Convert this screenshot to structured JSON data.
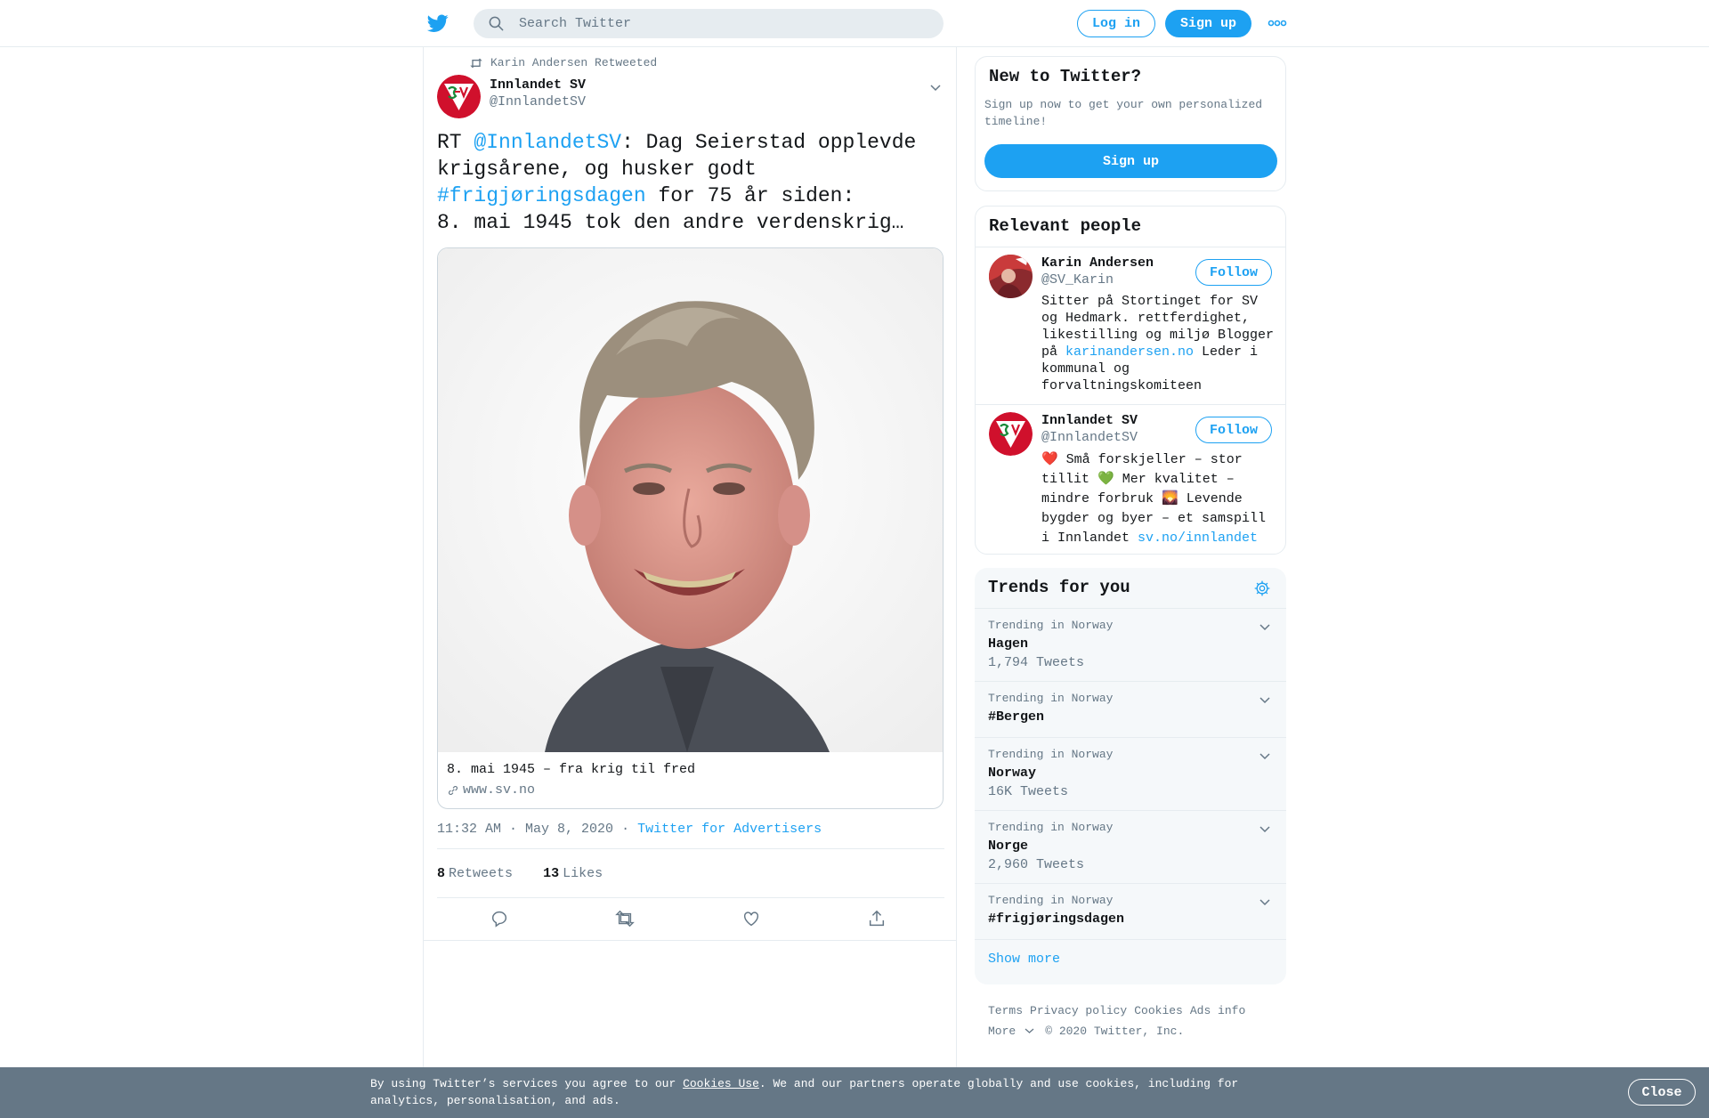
{
  "header": {
    "search_placeholder": "Search Twitter",
    "login_label": "Log in",
    "signup_label": "Sign up",
    "brand_color": "#1da1f2"
  },
  "tweet": {
    "retweeted_by": "Karin Andersen Retweeted",
    "author_name": "Innlandet SV",
    "author_handle": "@InnlandetSV",
    "text_prefix": "RT ",
    "mention": "@InnlandetSV",
    "text_part2": ": Dag Seierstad opplevde krigsårene, og husker godt ",
    "hashtag": "#frigjøringsdagen",
    "text_part3": " for 75 år siden:",
    "text_line4": "8. mai 1945 tok den andre verdenskrig…",
    "card_title": "8. mai 1945 – fra krig til fred",
    "card_domain": "www.sv.no",
    "timestamp": "11:32 AM · May 8, 2020",
    "separator": "·",
    "source": "Twitter for Advertisers",
    "retweets_count": "8",
    "retweets_label": "Retweets",
    "likes_count": "13",
    "likes_label": "Likes"
  },
  "new_to_twitter": {
    "title": "New to Twitter?",
    "text": "Sign up now to get your own personalized timeline!",
    "button": "Sign up"
  },
  "relevant_people": {
    "title": "Relevant people",
    "people": [
      {
        "name": "Karin Andersen",
        "handle": "@SV_Karin",
        "follow": "Follow",
        "bio": "Sitter på Stortinget for SV og Hedmark. rettferdighet, likestilling og miljø Blogger på ",
        "bio_link": "karinandersen.no",
        "bio_tail": " Leder i kommunal og forvaltningskomiteen"
      },
      {
        "name": "Innlandet SV",
        "handle": "@InnlandetSV",
        "follow": "Follow",
        "bio": "❤️ Små forskjeller – stor tillit 💚 Mer kvalitet – mindre forbruk 🌄 Levende bygder og byer – et samspill i Innlandet ",
        "bio_link": "sv.no/innlandet"
      }
    ]
  },
  "trends": {
    "title": "Trends for you",
    "items": [
      {
        "label": "Trending in Norway",
        "name": "Hagen",
        "count": "1,794 Tweets"
      },
      {
        "label": "Trending in Norway",
        "name": "#Bergen",
        "count": ""
      },
      {
        "label": "Trending in Norway",
        "name": "Norway",
        "count": "16K Tweets"
      },
      {
        "label": "Trending in Norway",
        "name": "Norge",
        "count": "2,960 Tweets"
      },
      {
        "label": "Trending in Norway",
        "name": "#frigjøringsdagen",
        "count": ""
      }
    ],
    "show_more": "Show more"
  },
  "footer": {
    "terms": "Terms",
    "privacy": "Privacy policy",
    "cookies": "Cookies",
    "ads": "Ads info",
    "more": "More",
    "copyright": "© 2020 Twitter, Inc."
  },
  "cookie_banner": {
    "text_before": "By using Twitter’s services you agree to our ",
    "link": "Cookies Use",
    "text_after": ". We and our partners operate globally and use cookies, including for analytics, personalisation, and ads.",
    "close": "Close"
  }
}
